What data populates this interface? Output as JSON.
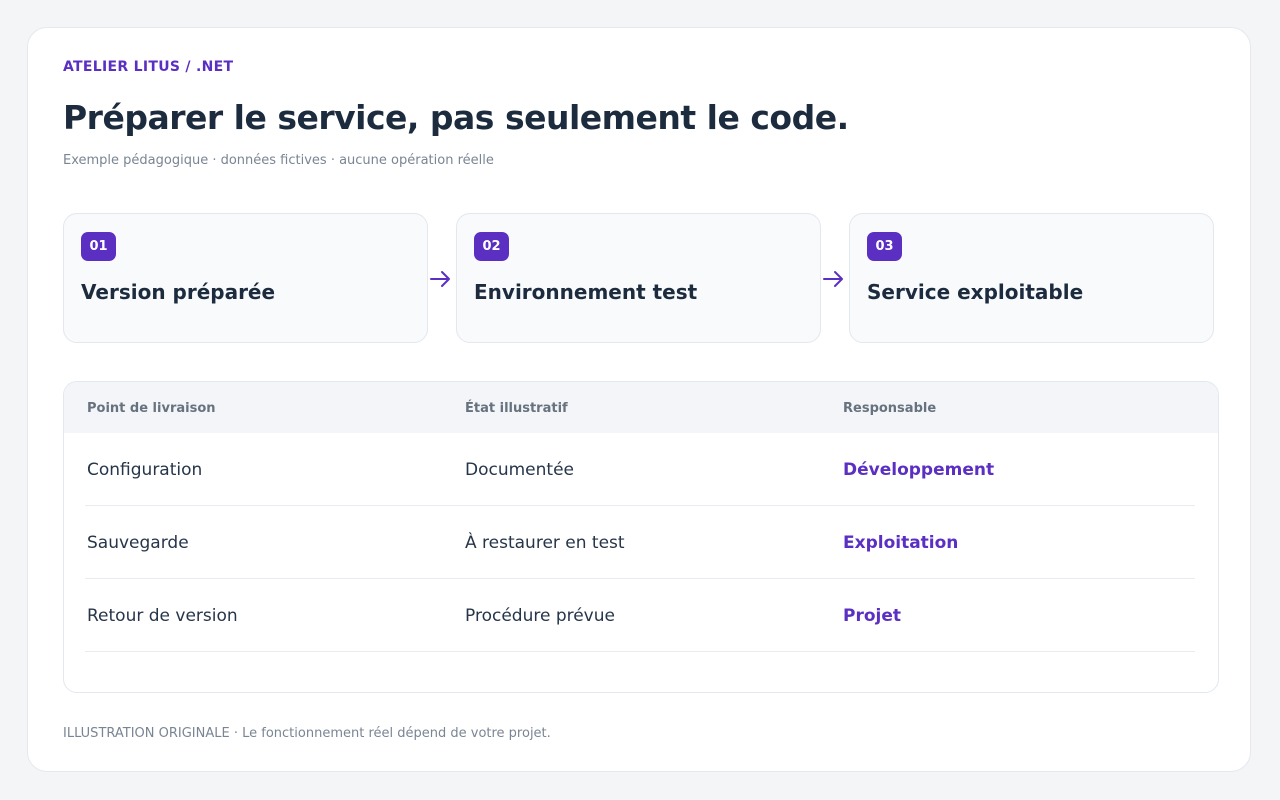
{
  "header": {
    "eyebrow": "ATELIER LITUS / .NET",
    "title": "Préparer le service, pas seulement le code.",
    "subtitle": "Exemple pédagogique · données fictives · aucune opération réelle"
  },
  "steps": [
    {
      "number": "01",
      "label": "Version préparée"
    },
    {
      "number": "02",
      "label": "Environnement test"
    },
    {
      "number": "03",
      "label": "Service exploitable"
    }
  ],
  "table": {
    "columns": [
      "Point de livraison",
      "État illustratif",
      "Responsable"
    ],
    "rows": [
      {
        "point": "Configuration",
        "state": "Documentée",
        "owner": "Développement"
      },
      {
        "point": "Sauvegarde",
        "state": "À restaurer en test",
        "owner": "Exploitation"
      },
      {
        "point": "Retour de version",
        "state": "Procédure prévue",
        "owner": "Projet"
      }
    ]
  },
  "footer": {
    "note": "ILLUSTRATION ORIGINALE · Le fonctionnement réel dépend de votre projet."
  },
  "colors": {
    "accent": "#5a2fc2",
    "text": "#1c2b3d",
    "muted": "#7a8594",
    "background": "#f3f5f7"
  }
}
